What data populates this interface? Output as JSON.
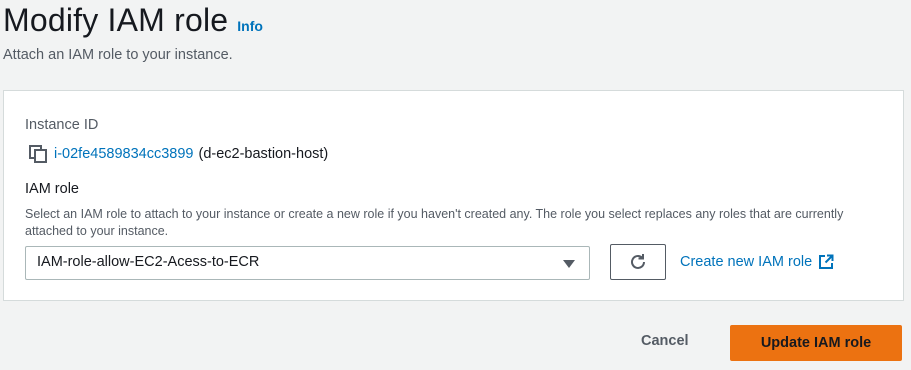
{
  "header": {
    "title": "Modify IAM role",
    "info_link": "Info",
    "subtitle": "Attach an IAM role to your instance."
  },
  "instance": {
    "label": "Instance ID",
    "id": "i-02fe4589834cc3899",
    "name": "(d-ec2-bastion-host)"
  },
  "iam_role": {
    "label": "IAM role",
    "description": "Select an IAM role to attach to your instance or create a new role if you haven't created any. The role you select replaces any roles that are currently attached to your instance.",
    "selected_value": "IAM-role-allow-EC2-Acess-to-ECR",
    "create_link": "Create new IAM role"
  },
  "footer": {
    "cancel_label": "Cancel",
    "submit_label": "Update IAM role"
  },
  "colors": {
    "link": "#0073bb",
    "primary_button": "#ec7211",
    "background": "#f2f3f3"
  }
}
